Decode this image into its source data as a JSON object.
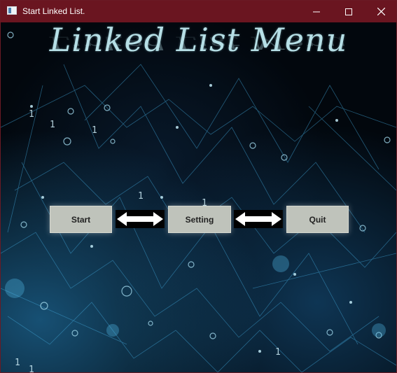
{
  "window": {
    "title": "Start Linked List.",
    "controls": [
      "minimize-icon",
      "maximize-icon",
      "close-icon"
    ],
    "titlebar_color": "#6a1520"
  },
  "main": {
    "heading": "Linked List Menu",
    "heading_color": "#b6dfe6",
    "buttons": {
      "start": "Start",
      "setting": "Setting",
      "quit": "Quit"
    },
    "connectors": [
      "double-arrow-icon",
      "double-arrow-icon"
    ],
    "background": "network-nodes-image"
  }
}
